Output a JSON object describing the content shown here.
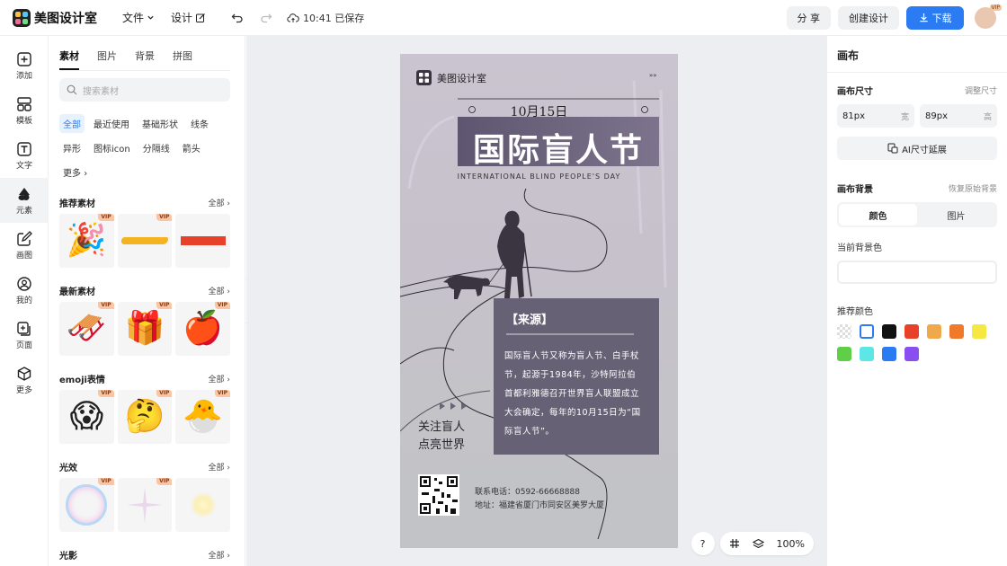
{
  "app": {
    "name": "美图设计室",
    "save_status": "10:41 已保存"
  },
  "menu": {
    "file": "文件",
    "design": "设计"
  },
  "top_actions": {
    "share": "分 享",
    "create": "创建设计",
    "download": "下载",
    "avatar_badge": "VIP"
  },
  "nav": [
    {
      "label": "添加",
      "icon": "plus-square-icon"
    },
    {
      "label": "模板",
      "icon": "template-icon"
    },
    {
      "label": "文字",
      "icon": "text-icon"
    },
    {
      "label": "元素",
      "icon": "shapes-icon"
    },
    {
      "label": "画图",
      "icon": "edit-icon"
    },
    {
      "label": "我的",
      "icon": "user-icon"
    },
    {
      "label": "页面",
      "icon": "page-add-icon"
    },
    {
      "label": "更多",
      "icon": "cube-icon"
    }
  ],
  "panel": {
    "tabs": [
      "素材",
      "图片",
      "背景",
      "拼图"
    ],
    "search_placeholder": "搜索素材",
    "chips": [
      "全部",
      "最近使用",
      "基础形状",
      "线条",
      "异形",
      "图标icon",
      "分隔线",
      "箭头",
      "更多"
    ],
    "all_label": "全部",
    "vip": "VIP",
    "sections": [
      {
        "title": "推荐素材",
        "items": [
          "🎉",
          "",
          ""
        ]
      },
      {
        "title": "最新素材",
        "items": [
          "🛷",
          "🎁",
          "🍎"
        ]
      },
      {
        "title": "emoji表情",
        "items": [
          "😱",
          "🤔",
          "🐣"
        ]
      },
      {
        "title": "光效",
        "items": [
          "",
          "",
          ""
        ]
      },
      {
        "title": "光影",
        "items": []
      }
    ]
  },
  "poster": {
    "brand": "美图设计室",
    "more": "»»",
    "date": "10月15日",
    "title": "国际盲人节",
    "subtitle": "INTERNATIONAL BLIND PEOPLE'S DAY",
    "source_title": "【来源】",
    "source_body": "国际盲人节又称为盲人节、白手杖节，起源于1984年，沙特阿拉伯首都利雅德召开世界盲人联盟成立大会确定，每年的10月15日为“国际盲人节”。",
    "slogan_1": "关注盲人",
    "slogan_2": "点亮世界",
    "phone": "联系电话：0592-66668888",
    "address": "地址：福建省厦门市同安区美罗大厦"
  },
  "tools": {
    "help": "?",
    "zoom": "100%"
  },
  "right_panel": {
    "title": "画布",
    "size_label": "画布尺寸",
    "adjust_size": "调整尺寸",
    "width_value": "81px",
    "width_unit": "宽",
    "height_value": "89px",
    "height_unit": "高",
    "ai_button": "AI尺寸延展",
    "bg_label": "画布背景",
    "restore_bg": "恢复原始背景",
    "seg_color": "颜色",
    "seg_image": "图片",
    "current_color_label": "当前背景色",
    "recommend_label": "推荐颜色",
    "swatches": [
      "transparent",
      "#ffffff",
      "#111111",
      "#e8412a",
      "#f0a94a",
      "#f07a2a",
      "#f7e742",
      "#5ecf47",
      "#5de6e6",
      "#2b7bf3",
      "#8a4df0"
    ]
  }
}
